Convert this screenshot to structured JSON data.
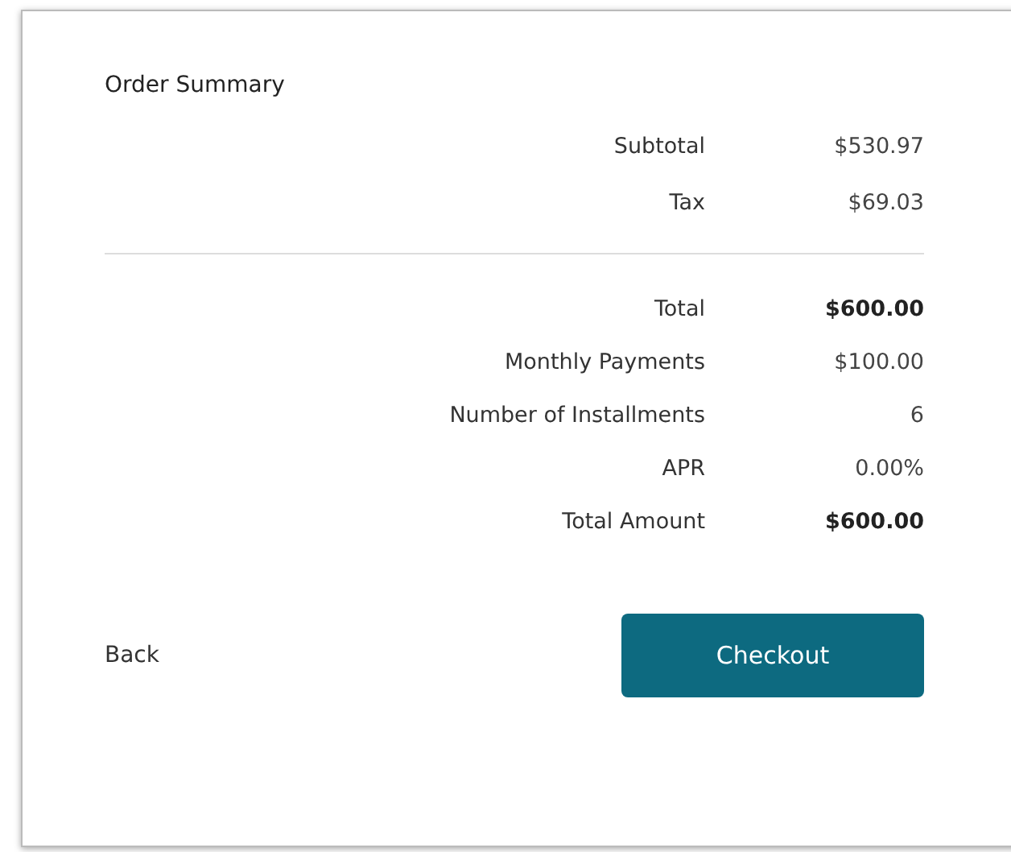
{
  "title": "Order Summary",
  "summary_rows": [
    {
      "label": "Subtotal",
      "value": "$530.97",
      "bold": false
    },
    {
      "label": "Tax",
      "value": "$69.03",
      "bold": false
    }
  ],
  "payment_rows": [
    {
      "label": "Total",
      "value": "$600.00",
      "bold": true
    },
    {
      "label": "Monthly Payments",
      "value": "$100.00",
      "bold": false
    },
    {
      "label": "Number of Installments",
      "value": "6",
      "bold": false
    },
    {
      "label": "APR",
      "value": "0.00%",
      "bold": false
    },
    {
      "label": "Total Amount",
      "value": "$600.00",
      "bold": true
    }
  ],
  "back_link": "Back",
  "checkout_button": "Checkout"
}
